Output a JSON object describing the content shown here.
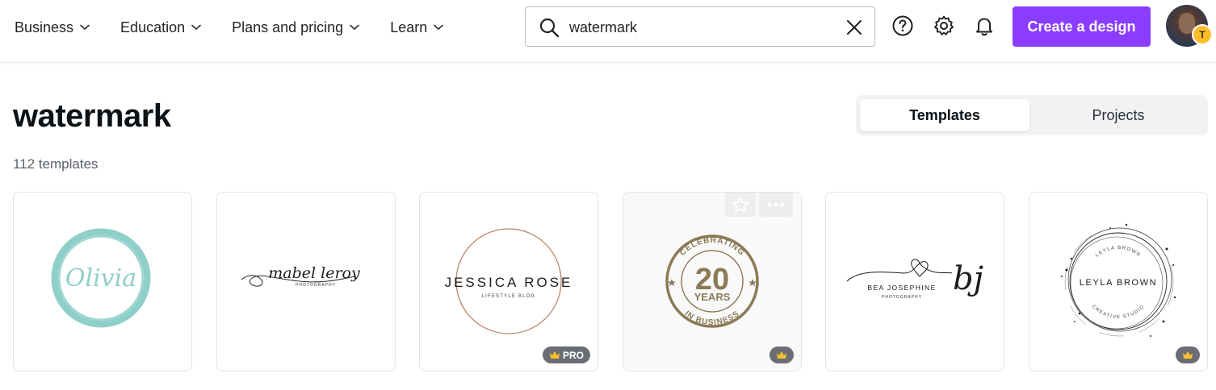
{
  "nav": [
    {
      "label": "Business"
    },
    {
      "label": "Education"
    },
    {
      "label": "Plans and pricing"
    },
    {
      "label": "Learn"
    }
  ],
  "search": {
    "value": "watermark",
    "placeholder": "Search"
  },
  "header": {
    "create_label": "Create a design",
    "avatar_initial": "T"
  },
  "page": {
    "title": "watermark",
    "count": "112 templates"
  },
  "tabs": [
    {
      "label": "Templates"
    },
    {
      "label": "Projects"
    }
  ],
  "cards": [
    {
      "text": "Olivia",
      "badge": ""
    },
    {
      "text": "mabel leroy",
      "sub": "PHOTOGRAPHY",
      "badge": ""
    },
    {
      "text": "JESSICA ROSE",
      "sub": "LIFESTYLE BLOG",
      "badge": "PRO"
    },
    {
      "text": "20",
      "sub": "YEARS",
      "ring_top": "CELEBRATING",
      "ring_bottom": "IN BUSINESS",
      "badge": ""
    },
    {
      "text": "BEA JOSEPHINE",
      "sub": "PHOTOGRAPHY",
      "mono": "bj",
      "badge": ""
    },
    {
      "text": "LEYLA BROWN",
      "ring_top": "LEYLA BROWN",
      "ring_bottom": "CREATIVE STUDIO",
      "badge": ""
    }
  ],
  "colors": {
    "accent": "#8b3dff",
    "teal": "#8fcfc9",
    "olive": "#8b7a55",
    "crown": "#f8c12d"
  }
}
